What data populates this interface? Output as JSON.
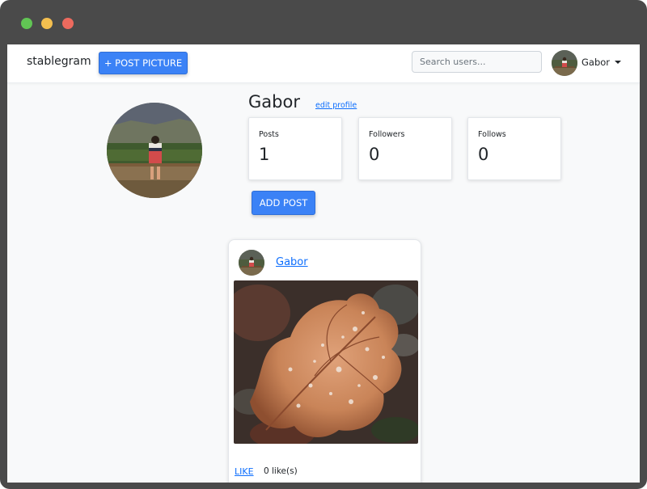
{
  "window": {
    "traffic_lights": [
      "green",
      "yellow",
      "red"
    ]
  },
  "navbar": {
    "brand": "stablegram",
    "post_picture_label": "+ POST PICTURE",
    "search_placeholder": "Search users...",
    "user_name": "Gabor"
  },
  "profile": {
    "name": "Gabor",
    "edit_label": "edit profile",
    "stats": [
      {
        "label": "Posts",
        "value": "1"
      },
      {
        "label": "Followers",
        "value": "0"
      },
      {
        "label": "Follows",
        "value": "0"
      }
    ],
    "add_post_label": "ADD POST"
  },
  "post": {
    "author": "Gabor",
    "like_label": "LIKE",
    "likes_text": "0 like(s)"
  },
  "colors": {
    "accent": "#3b82f6",
    "link": "#0d6efd",
    "page_bg": "#f8f9fa",
    "frame": "#4a4a4a"
  }
}
